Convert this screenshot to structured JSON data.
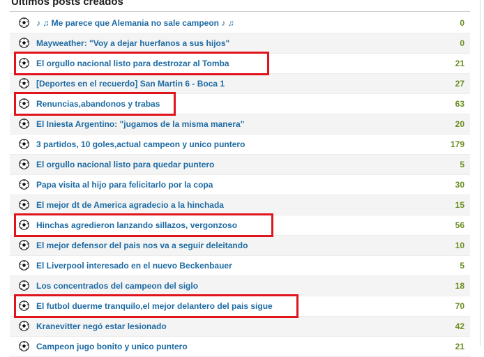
{
  "panel": {
    "title": "Ultimos posts creados"
  },
  "posts": [
    {
      "title": "♪ ♫ Me parece que Alemania no sale campeon ♪ ♫",
      "count": "0",
      "highlighted": false
    },
    {
      "title": "Mayweather: \"Voy a dejar huerfanos a sus hijos\"",
      "count": "0",
      "highlighted": false
    },
    {
      "title": "El orgullo nacional listo para destrozar al Tomba",
      "count": "21",
      "highlighted": true
    },
    {
      "title": "[Deportes en el recuerdo] San Martin 6 - Boca 1",
      "count": "27",
      "highlighted": false
    },
    {
      "title": "Renuncias,abandonos y trabas",
      "count": "63",
      "highlighted": true
    },
    {
      "title": "El Iniesta Argentino: \"jugamos de la misma manera\"",
      "count": "20",
      "highlighted": false
    },
    {
      "title": "3 partidos, 10 goles,actual campeon y unico puntero",
      "count": "179",
      "highlighted": false
    },
    {
      "title": "El orgullo nacional listo para quedar puntero",
      "count": "5",
      "highlighted": false
    },
    {
      "title": "Papa visita al hijo para felicitarlo por la copa",
      "count": "30",
      "highlighted": false
    },
    {
      "title": "El mejor dt de America agradecio a la hinchada",
      "count": "15",
      "highlighted": false
    },
    {
      "title": "Hinchas agredieron lanzando sillazos, vergonzoso",
      "count": "56",
      "highlighted": true
    },
    {
      "title": "El mejor defensor del pais nos va a seguir deleitando",
      "count": "10",
      "highlighted": false
    },
    {
      "title": "El Liverpool interesado en el nuevo Beckenbauer",
      "count": "5",
      "highlighted": false
    },
    {
      "title": "Los concentrados del campeon del siglo",
      "count": "18",
      "highlighted": false
    },
    {
      "title": "El futbol duerme tranquilo,el mejor delantero del pais sigue",
      "count": "70",
      "highlighted": true
    },
    {
      "title": "Kranevitter negó estar lesionado",
      "count": "42",
      "highlighted": false
    },
    {
      "title": "Campeon jugo bonito y unico puntero",
      "count": "21",
      "highlighted": false
    }
  ],
  "icons": {
    "row_icon": "soccer-ball-icon"
  },
  "colors": {
    "link": "#1e6ba3",
    "count": "#6b8e23",
    "highlight": "#e0141c",
    "alt_row": "#f4f4f4"
  }
}
